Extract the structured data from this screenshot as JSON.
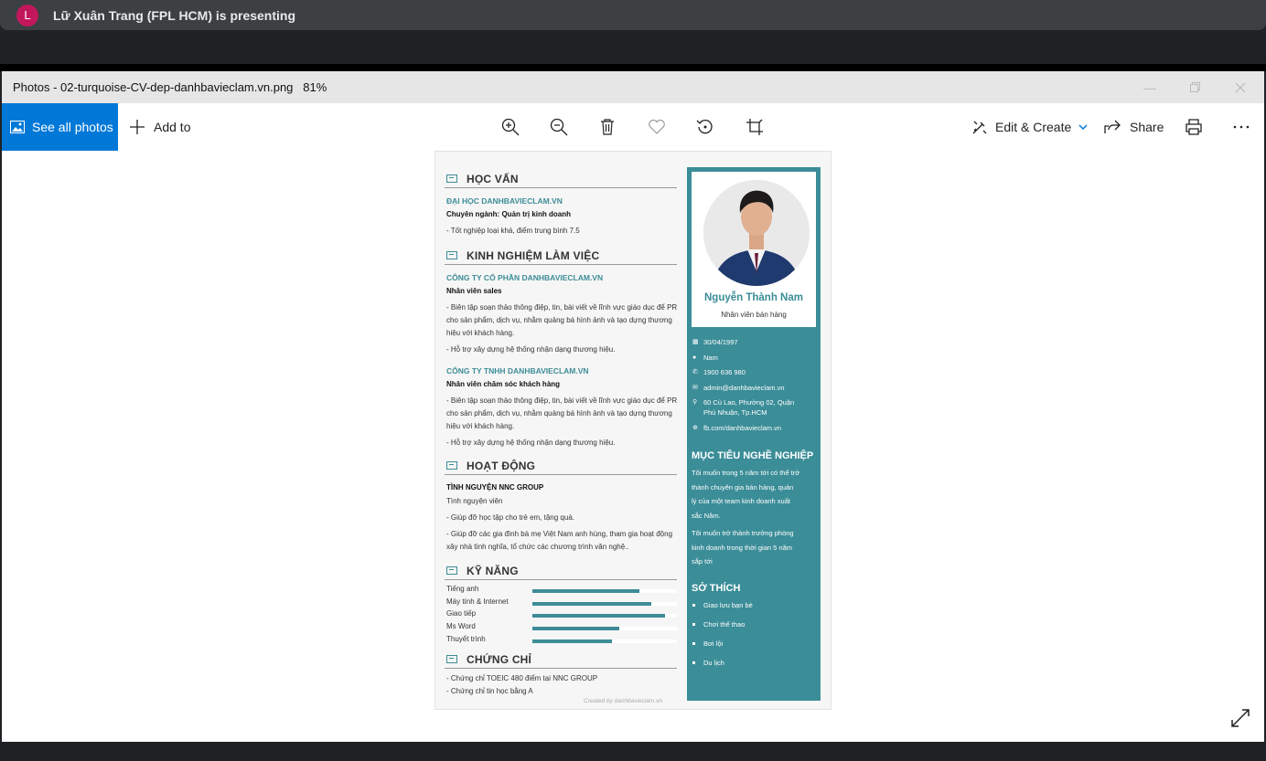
{
  "meet": {
    "avatar_letter": "L",
    "presenter": "Lữ Xuân Trang (FPL HCM) is presenting"
  },
  "window": {
    "title": "Photos - 02-turquoise-CV-dep-danhbavieclam.vn.png",
    "zoom": "81%"
  },
  "toolbar": {
    "see_all": "See all photos",
    "add_to": "Add to",
    "edit_create": "Edit & Create",
    "share": "Share"
  },
  "cv": {
    "education": {
      "title": "HỌC VẤN",
      "school": "ĐẠI HỌC DANHBAVIECLAM.VN",
      "major": "Chuyên ngành: Quản trị kinh doanh",
      "detail": "- Tốt nghiệp loại khá, điểm trung bình 7.5"
    },
    "experience": {
      "title": "KINH NGHIỆM LÀM VIỆC",
      "jobs": [
        {
          "company": "CÔNG TY CỔ PHẦN DANHBAVIECLAM.VN",
          "position": "Nhân viên sales",
          "line1": "- Biên tập soạn thảo thông điệp, tin, bài viết về lĩnh vực giáo dục để PR",
          "line2": "cho sản phẩm, dịch vụ, nhằm quảng bá hình ảnh và tạo dựng thương",
          "line3": "hiệu với khách hàng.",
          "line4": "- Hỗ trợ xây dựng hệ thống nhận dạng thương hiệu."
        },
        {
          "company": "CÔNG TY TNHH DANHBAVIECLAM.VN",
          "position": "Nhân viên chăm sóc khách hàng",
          "line1": "- Biên tập soạn thảo thông điệp, tin, bài viết về lĩnh vực giáo dục để PR",
          "line2": "cho sản phẩm, dịch vụ, nhằm quảng bá hình ảnh và tạo dựng thương",
          "line3": "hiệu với khách hàng.",
          "line4": "- Hỗ trợ xây dựng hệ thống nhận dạng thương hiệu."
        }
      ]
    },
    "activities": {
      "title": "HOẠT ĐỘNG",
      "org": "TÌNH NGUYỆN NNC GROUP",
      "role": "Tình nguyện viên",
      "line1": "- Giúp đỡ học tập cho trẻ em, tặng quà.",
      "line2": "- Giúp đỡ các gia đình bà mẹ Việt Nam anh hùng, tham gia hoạt động",
      "line3": "xây nhà tình nghĩa, tổ chức các chương trình văn nghệ.."
    },
    "skills": {
      "title": "KỸ NĂNG",
      "items": [
        {
          "name": "Tiếng anh",
          "level": 0.74
        },
        {
          "name": "Máy tính & Internet",
          "level": 0.82
        },
        {
          "name": "Giao tiếp",
          "level": 0.92
        },
        {
          "name": "Ms Word",
          "level": 0.6
        },
        {
          "name": "Thuyết trình",
          "level": 0.55
        }
      ]
    },
    "certificates": {
      "title": "CHỨNG CHỈ",
      "item1": "- Chứng chỉ TOEIC 480 điểm tại NNC GROUP",
      "item2": "- Chứng chỉ tin học bằng A"
    },
    "credit": "Created by danhbavieclam.vn",
    "profile": {
      "name": "Nguyễn Thành Nam",
      "role": "Nhân viên bán hàng",
      "birthday": "30/04/1997",
      "gender": "Nam",
      "phone": "1900 636 980",
      "email": "admin@danhbavieclam.vn",
      "address1": "60 Cù Lao, Phường 02, Quận",
      "address2": "Phú Nhuận, Tp.HCM",
      "facebook": "fb.com/danhbavieclam.vn"
    },
    "objective": {
      "title": "MỤC TIÊU NGHỀ NGHIỆP",
      "p1l1": "Tôi muốn trong 5 năm tới có thể trở",
      "p1l2": "thành chuyên gia bán hàng, quản",
      "p1l3": "lý của một team kinh doanh xuất",
      "p1l4": "sắc Nâm.",
      "p2l1": "Tôi muốn trở thành trưởng phòng",
      "p2l2": "kinh doanh trong thời gian 5 năm",
      "p2l3": "sắp tới"
    },
    "hobbies": {
      "title": "SỞ THÍCH",
      "items": [
        "Giao lưu bạn bè",
        "Chơi thể thao",
        "Bơi lội",
        "Du lịch"
      ]
    }
  }
}
